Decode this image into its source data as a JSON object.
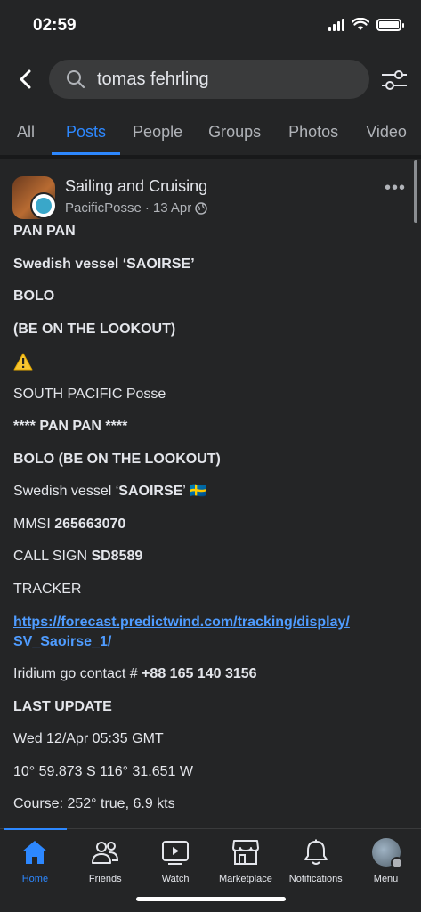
{
  "status_bar": {
    "time": "02:59"
  },
  "search": {
    "query": "tomas fehrling"
  },
  "tabs": [
    {
      "label": "All"
    },
    {
      "label": "Posts"
    },
    {
      "label": "People"
    },
    {
      "label": "Groups"
    },
    {
      "label": "Photos"
    },
    {
      "label": "Video"
    }
  ],
  "post": {
    "group_name": "Sailing and Cruising",
    "author": "PacificPosse",
    "date": "13 Apr",
    "separator": "·",
    "lines": {
      "l1": "PAN PAN",
      "l2": "Swedish vessel ‘SAOIRSE’",
      "l3": "BOLO",
      "l4": "(BE ON THE LOOKOUT)",
      "l5": "SOUTH PACIFIC  Posse",
      "l6": "**** PAN PAN ****",
      "l7": "BOLO (BE ON THE LOOKOUT)",
      "l8a": "Swedish vessel ‘",
      "l8b": "SAOIRSE",
      "l8c": "’ ",
      "l8flag": "🇸🇪",
      "l9a": "MMSI ",
      "l9b": "265663070",
      "l10a": "CALL SIGN ",
      "l10b": "SD8589",
      "l11": "TRACKER",
      "link": "https://forecast.predictwind.com/tracking/display/SV_Saoirse_1/",
      "link_part1": "https://forecast.predictwind.com/tracking/display/",
      "link_part2": "SV_Saoirse_1/",
      "l12a": "Iridium go contact # ",
      "l12b": "+88 165 140 3156",
      "l13": "LAST UPDATE",
      "l14": "Wed 12/Apr 05:35 GMT",
      "l15": "10° 59.873 S  116° 31.651 W",
      "l16": "Course:   252° true,    6.9 kts"
    }
  },
  "bottom_nav": [
    {
      "label": "Home",
      "icon": "home-icon"
    },
    {
      "label": "Friends",
      "icon": "friends-icon"
    },
    {
      "label": "Watch",
      "icon": "watch-icon"
    },
    {
      "label": "Marketplace",
      "icon": "marketplace-icon"
    },
    {
      "label": "Notifications",
      "icon": "bell-icon"
    },
    {
      "label": "Menu",
      "icon": "profile-avatar"
    }
  ],
  "colors": {
    "accent": "#2d88ff",
    "background": "#242526",
    "link": "#4f9cff"
  }
}
